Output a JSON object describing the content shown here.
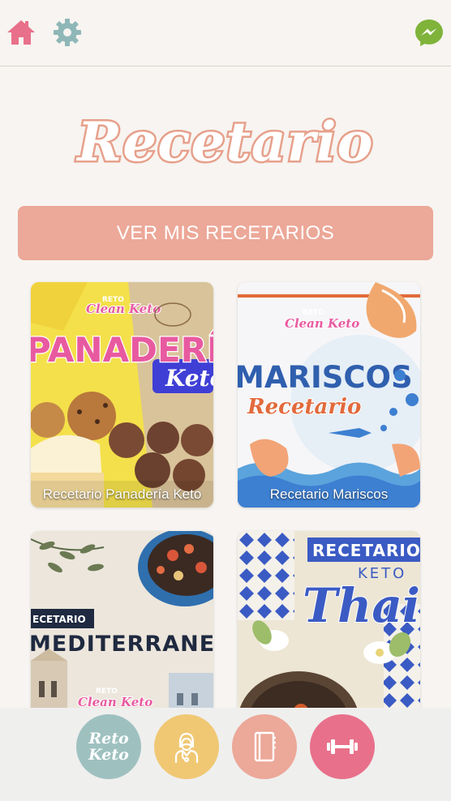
{
  "header": {
    "home_icon": "home-icon",
    "settings_icon": "gear-icon",
    "messenger_icon": "messenger-icon"
  },
  "logo_text": "Recetario",
  "cta_label": "VER MIS RECETARIOS",
  "cards": [
    {
      "caption": "Recetario Panadería Keto",
      "badge_top": "RETO",
      "badge_main": "Clean Keto",
      "headline": "PANADERÍA",
      "subline": "Keto"
    },
    {
      "caption": "Recetario Mariscos",
      "badge_top": "RETO",
      "badge_main": "Clean Keto",
      "headline": "MARISCOS",
      "subline": "Recetario"
    },
    {
      "caption": "",
      "badge_top": "RETO",
      "badge_main": "Clean Keto",
      "tag": "ECETARIO",
      "headline": "MEDITERRANEO"
    },
    {
      "caption": "",
      "tag": "RECETARIO",
      "tag2": "KETO",
      "headline": "Thai"
    }
  ],
  "bottom_nav": {
    "tab1_line1": "Reto",
    "tab1_line2": "Keto",
    "tab2_icon": "doctor-icon",
    "tab3_icon": "notebook-icon",
    "tab4_icon": "dumbbell-icon"
  },
  "colors": {
    "background": "#f7f4f1",
    "accent": "#eca898",
    "home": "#e8708a",
    "gear": "#8fb7b8",
    "messenger": "#7fb33a",
    "tab_teal": "#9ec1c0",
    "tab_yellow": "#f0c874",
    "tab_peach": "#eca898",
    "tab_pink": "#e8708a"
  }
}
